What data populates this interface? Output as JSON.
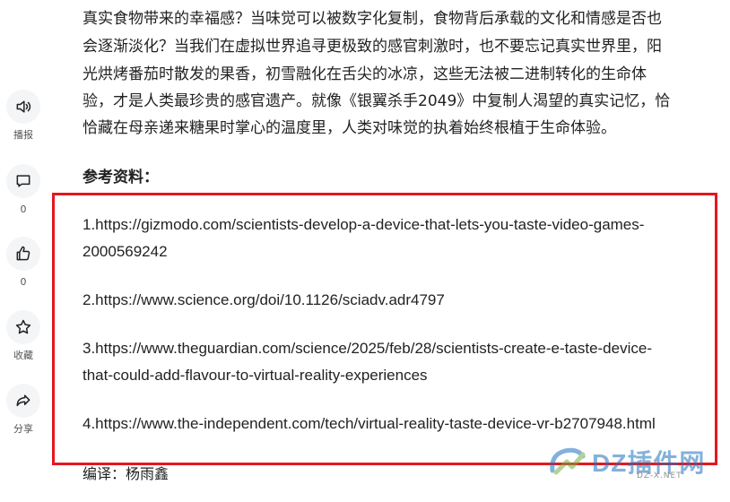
{
  "sidebar": {
    "broadcast_label": "播报",
    "comment_count": "0",
    "like_count": "0",
    "favorite_label": "收藏",
    "share_label": "分享"
  },
  "article": {
    "paragraph_lines": [
      "真实食物带来的幸福感？当味觉可以被数字化复制，食物背后承载的文化和情感是否也",
      "会逐渐淡化？当我们在虚拟世界追寻更极致的感官刺激时，也不要忘记真实世界里，阳",
      "光烘烤番茄时散发的果香，初雪融化在舌尖的冰凉，这些无法被二进制转化的生命体",
      "验，才是人类最珍贵的感官遗产。就像《银翼杀手2049》中复制人渴望的真实记忆，恰",
      "恰藏在母亲递来糖果时掌心的温度里，人类对味觉的执着始终根植于生命体验。"
    ],
    "references_heading": "参考资料：",
    "references": [
      {
        "line1": "1.https://gizmodo.com/scientists-develop-a-device-that-lets-you-taste-video-games-",
        "line2": "2000569242"
      },
      {
        "line1": "2.https://www.science.org/doi/10.1126/sciadv.adr4797",
        "line2": ""
      },
      {
        "line1": "3.https://www.theguardian.com/science/2025/feb/28/scientists-create-e-taste-device-",
        "line2": "that-could-add-flavour-to-virtual-reality-experiences"
      },
      {
        "line1": "4.https://www.the-independent.com/tech/virtual-reality-taste-device-vr-b2707948.html",
        "line2": ""
      }
    ],
    "editor": "编译：杨雨鑫"
  },
  "watermark": {
    "brand": "DZ插件网",
    "url": "DZ-X.NET"
  },
  "colors": {
    "highlight": "#e5171f",
    "watermark_blue": "#1e73be",
    "watermark_green": "#6cb33f"
  }
}
